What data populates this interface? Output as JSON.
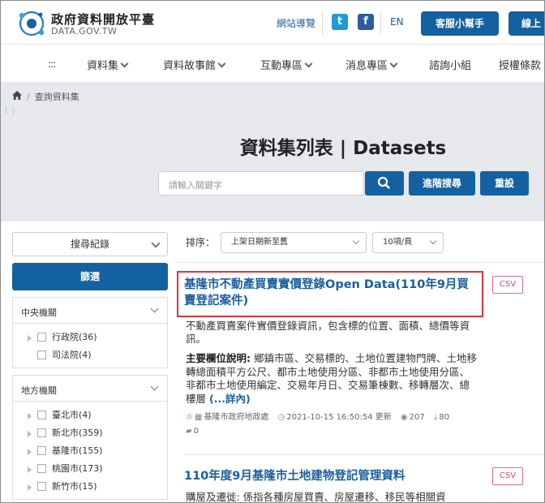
{
  "header": {
    "logo_title": "政府資料開放平臺",
    "logo_sub": "DATA.GOV.TW",
    "site_nav": "網站導覽",
    "twitter_glyph": "t",
    "facebook_glyph": "f",
    "lang": "EN",
    "help_btn": "客服小幫手",
    "online_btn": "線上"
  },
  "nav": {
    "grid": ":::",
    "items": [
      "資料集",
      "資料故事館",
      "互動專區",
      "消息專區",
      "諮詢小組",
      "授權條款"
    ]
  },
  "breadcrumb": {
    "current": "查詢資料集"
  },
  "hero": {
    "title": "資料集列表 | Datasets",
    "search_placeholder": "請輸入關鍵字",
    "advanced_search": "進階搜尋",
    "reset": "重設"
  },
  "sidebar": {
    "search_history": "搜尋紀錄",
    "filter_btn": "篩選",
    "central": {
      "title": "中央機關",
      "options": [
        "行政院(36)",
        "司法院(4)"
      ]
    },
    "local": {
      "title": "地方機關",
      "options": [
        "臺北市(4)",
        "新北市(359)",
        "基隆市(155)",
        "桃園市(173)",
        "新竹市(15)"
      ]
    }
  },
  "sort": {
    "label": "排序：",
    "order": "上架日期新至舊",
    "per_page": "10項/頁"
  },
  "results": [
    {
      "title": "基隆市不動產買賣實價登錄Open Data(110年9月買賣登記案件)",
      "format": "CSV",
      "description": "不動產買賣案件實價登錄資訊，包含標的位置、面積、總價等資訊。",
      "fields_label": "主要欄位說明:",
      "fields": " 鄉鎮市區、交易標的、土地位置建物門牌、土地移轉總面積平方公尺、都市土地使用分區、非都市土地使用分區、非都市土地使用編定、交易年月日、交易筆棟數、移轉層次、總樓層",
      "more": "(...詳內)",
      "agency": "基隆市政府地政處",
      "updated": "2021-10-15 16:50:54 更新",
      "views": "207",
      "downloads": "80",
      "comments": "0"
    },
    {
      "title": "110年度9月基隆市土地建物登記管理資料",
      "format": "CSV",
      "description": "購屋及遷徙: 係指各種房屋買賣、房屋遷移、移民等相關資"
    }
  ]
}
